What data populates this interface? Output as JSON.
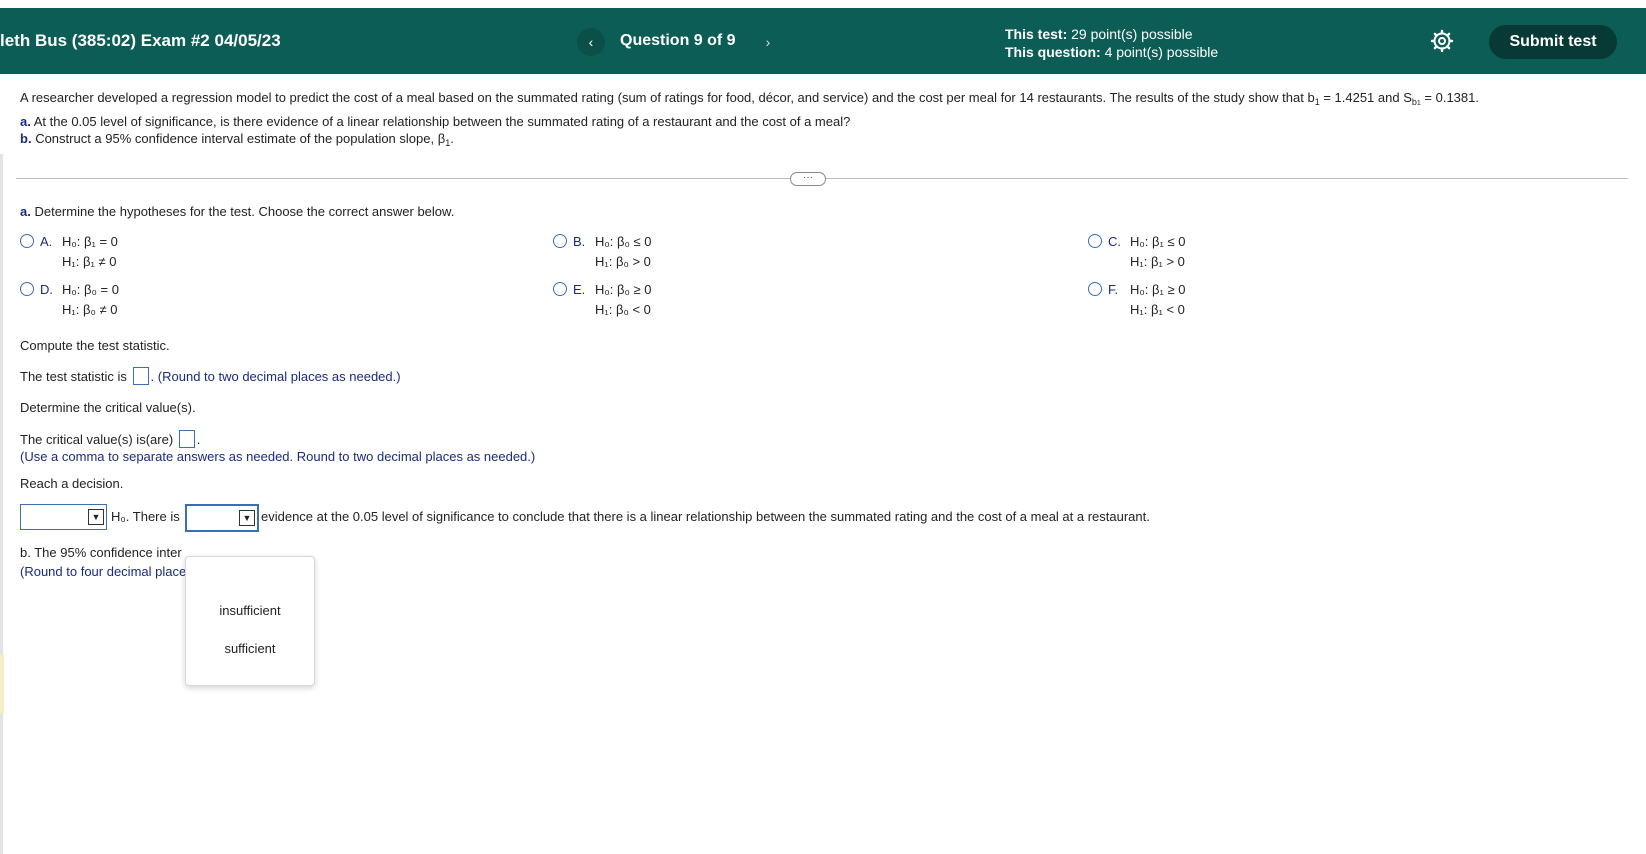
{
  "header": {
    "exam_title": "leth Bus (385:02) Exam #2 04/05/23",
    "prev_glyph": "‹",
    "question_label": "Question 9 of 9",
    "next_glyph": "›",
    "test_points_label": "This test:",
    "test_points_value": "29 point(s) possible",
    "question_points_label": "This question:",
    "question_points_value": "4 point(s) possible",
    "settings_icon": "gear-icon",
    "submit_label": "Submit test",
    "color": "#0c5d55"
  },
  "problem": {
    "intro_text": "A researcher developed a regression model to predict the cost of a meal based on the summated rating (sum of ratings for food, décor, and service) and the cost per meal for 14 restaurants. The results of the study show that b",
    "b1_value_text": " = 1.4251 and S",
    "sb1_value_text": " = 0.1381.",
    "part_a_label": "a.",
    "part_a_text": "At the 0.05 level of significance, is there evidence of a linear relationship between the summated rating of a restaurant and the cost of a meal?",
    "part_b_label": "b.",
    "part_b_text": "Construct a 95% confidence interval estimate of the population slope, β",
    "part_b_end": "."
  },
  "more_button": "···",
  "section_a": {
    "prompt_label": "a.",
    "prompt_text": "Determine the hypotheses for the test. Choose the correct answer below.",
    "options": [
      {
        "letter": "A.",
        "h0": "H₀: β₁ = 0",
        "h1": "H₁: β₁ ≠ 0"
      },
      {
        "letter": "B.",
        "h0": "H₀: β₀ ≤ 0",
        "h1": "H₁: β₀ > 0"
      },
      {
        "letter": "C.",
        "h0": "H₀: β₁ ≤ 0",
        "h1": "H₁: β₁ > 0"
      },
      {
        "letter": "D.",
        "h0": "H₀: β₀ = 0",
        "h1": "H₁: β₀ ≠ 0"
      },
      {
        "letter": "E.",
        "h0": "H₀: β₀ ≥ 0",
        "h1": "H₁: β₀ < 0"
      },
      {
        "letter": "F.",
        "h0": "H₀: β₁ ≥ 0",
        "h1": "H₁: β₁ < 0"
      }
    ],
    "compute_text": "Compute the test statistic.",
    "test_stat_prefix": "The test statistic is",
    "test_stat_hint": "(Round to two decimal places as needed.)",
    "critical_prompt": "Determine the critical value(s).",
    "critical_prefix": "The critical value(s) is(are)",
    "critical_hint": "(Use a comma to separate answers as needed. Round to two decimal places as needed.)",
    "decision_prompt": "Reach a decision.",
    "decision_h0": "H₀. There is",
    "decision_tail": "evidence at the 0.05 level of significance to conclude that there is a linear relationship between the summated rating and the cost of a meal at a restaurant.",
    "dropdown_options": [
      "insufficient",
      "sufficient"
    ]
  },
  "section_b": {
    "text_partial": "b. The 95% confidence inter",
    "hint_partial": "(Round to four decimal place"
  }
}
